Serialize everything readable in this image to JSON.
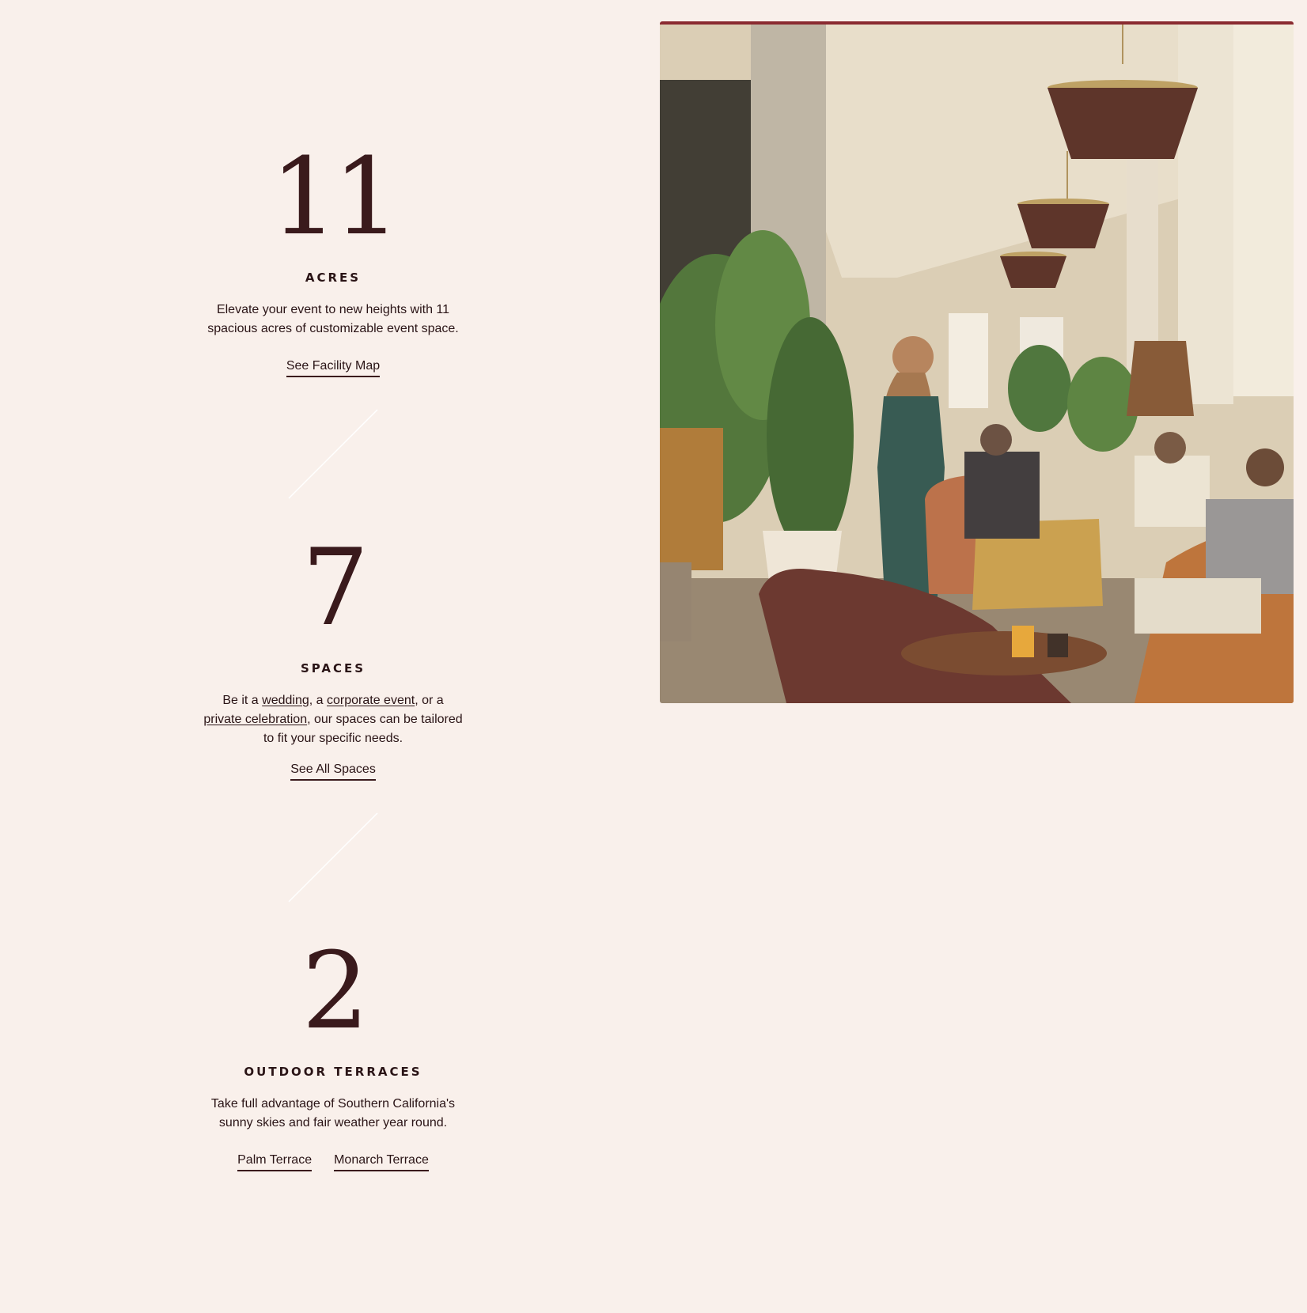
{
  "stats": [
    {
      "number": "11",
      "label": "ACRES",
      "description": "Elevate your event to new heights with 11 spacious acres of customizable event space.",
      "links": [
        {
          "label": "See Facility Map"
        }
      ]
    },
    {
      "number": "7",
      "label": "SPACES",
      "description_parts": {
        "p1": "Be it a ",
        "link_wedding": "wedding",
        "p2": ", a ",
        "link_corporate": "corporate event",
        "p3": ", or a ",
        "link_private": "private celebration",
        "p4": ", our spaces can be tailored to fit your specific needs."
      },
      "links": [
        {
          "label": "See All Spaces"
        }
      ]
    },
    {
      "number": "2",
      "label": "OUTDOOR TERRACES",
      "description": "Take full advantage of Southern California's sunny skies and fair weather year round.",
      "links": [
        {
          "label": "Palm Terrace"
        },
        {
          "label": "Monarch Terrace"
        }
      ]
    }
  ],
  "colors": {
    "background": "#f9f0eb",
    "text": "#2a1416",
    "accent": "#8a2a30"
  }
}
